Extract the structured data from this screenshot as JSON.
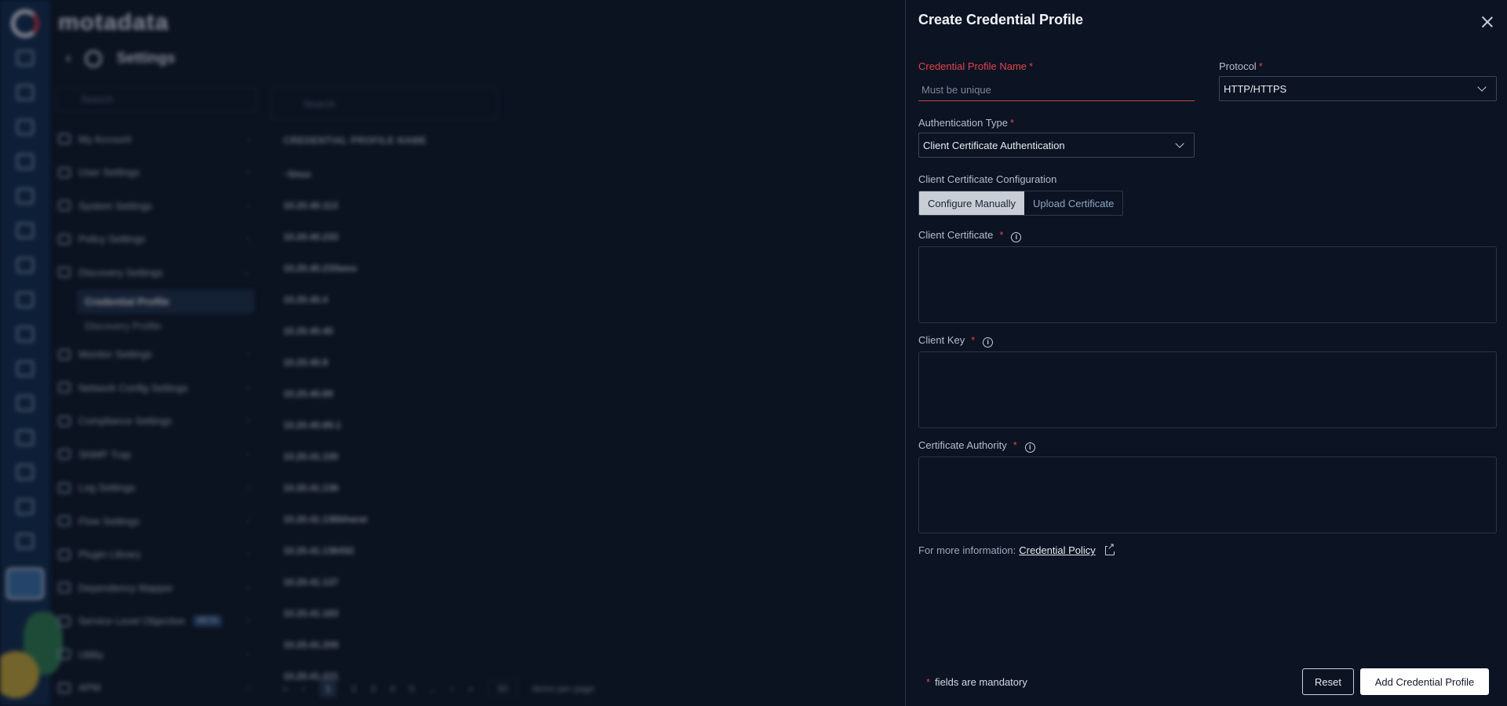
{
  "background": {
    "brand": "motadata",
    "page_title": "Settings",
    "menu_search_placeholder": "Search",
    "menu": [
      {
        "label": "My Account"
      },
      {
        "label": "User Settings"
      },
      {
        "label": "System Settings"
      },
      {
        "label": "Policy Settings"
      },
      {
        "label": "Discovery Settings",
        "expanded": true,
        "children": [
          "Credential Profile",
          "Discovery Profile"
        ]
      },
      {
        "label": "Monitor Settings"
      },
      {
        "label": "Network Config Settings"
      },
      {
        "label": "Compliance Settings"
      },
      {
        "label": "SNMP Trap"
      },
      {
        "label": "Log Settings"
      },
      {
        "label": "Flow Settings"
      },
      {
        "label": "Plugin Library"
      },
      {
        "label": "Dependency Mapper"
      },
      {
        "label": "Service Level Objective",
        "badge": "BETA"
      },
      {
        "label": "Utility"
      },
      {
        "label": "APM"
      }
    ],
    "list_search_placeholder": "Search",
    "column_header": "CREDENTIAL PROFILE NAME",
    "rows": [
      "~linux",
      "10.20.40.113",
      "10.20.40.233",
      "10.20.40.233woo",
      "10.20.40.4",
      "10.20.40.45",
      "10.20.40.8",
      "10.20.40.89",
      "10.20.40.89.1",
      "10.20.41.105",
      "10.20.41.136",
      "10.20.41.136bharat",
      "10.20.41.136432",
      "10.20.41.137",
      "10.20.41.183",
      "10.20.41.209",
      "10.20.41.221"
    ],
    "pager": {
      "pages": [
        "1",
        "2",
        "3",
        "4",
        "5",
        "..."
      ],
      "per_page": "50",
      "per_page_label": "items per page"
    }
  },
  "drawer": {
    "title": "Create Credential Profile",
    "name_field": {
      "label": "Credential Profile Name",
      "placeholder": "Must be unique",
      "value": ""
    },
    "protocol": {
      "label": "Protocol",
      "value": "HTTP/HTTPS"
    },
    "auth_type": {
      "label": "Authentication Type",
      "value": "Client Certificate Authentication"
    },
    "cert_config": {
      "label": "Client Certificate Configuration",
      "options": [
        "Configure Manually",
        "Upload Certificate"
      ],
      "selected": "Configure Manually"
    },
    "client_certificate": {
      "label": "Client Certificate"
    },
    "client_key": {
      "label": "Client Key"
    },
    "certificate_authority": {
      "label": "Certificate Authority"
    },
    "more_info": {
      "prefix": "For more information:",
      "link": "Credential Policy"
    },
    "footer": {
      "mandatory_note": "fields are mandatory",
      "reset": "Reset",
      "submit": "Add Credential Profile"
    }
  },
  "colors": {
    "required": "#e0444c",
    "drawer_bg": "#0c1322",
    "primary_button": "#ffffff"
  }
}
